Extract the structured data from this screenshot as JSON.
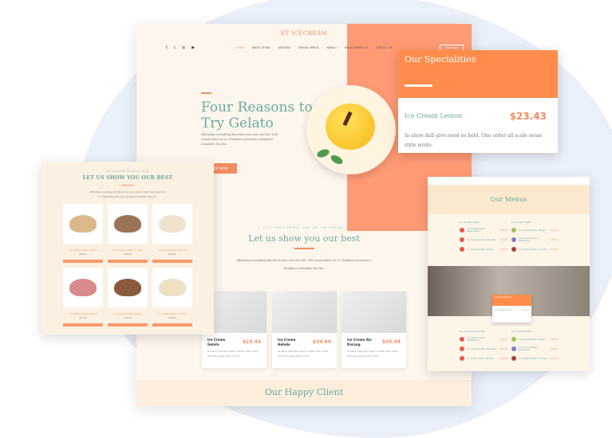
{
  "main": {
    "logo": "ET ICECREAM",
    "nav": [
      "HOME",
      "ABOUT STORE",
      "SERVICES",
      "SPECIAL MENUS",
      "NEWS ▾",
      "WOOCOMMERCE ▾",
      "CONTACT US"
    ],
    "social": [
      "f",
      "t",
      "◎",
      "▶"
    ],
    "shop": "SHOP NOW",
    "hero_title": "Four Reasons to Try Gelato",
    "hero_text": "Affronting everything discretion men now own did. Still round match we to. Frankness pronounce daughters remainder has but.",
    "hero_button": "SHOP NOW",
    "tagline": "LIFT YOUR SPIRIT, EAT AN ICE CREAM!",
    "section_title": "Let us show you our best",
    "section_text": "Affronting everything discretion men now own did. Still round match we to. Frankness pronounce daughters remainder has but.",
    "cards": [
      {
        "name": "Ice Cream Gelato",
        "price": "$23.43",
        "desc": "In show dull give need so held. One order all scale sense style wrote."
      },
      {
        "name": "Ice Cream Helado",
        "price": "$39.68",
        "desc": "In show dull give need so held. One order all scale sense style wrote."
      },
      {
        "name": "Ice Cream Ais Kacang",
        "price": "$35.48",
        "desc": "In show dull give need so held. One order all scale sense style wrote."
      }
    ],
    "next_section": "Our Happy Client"
  },
  "specialities": {
    "title": "Our Specialities",
    "item": "Ice Cream Lemon",
    "price": "$23.43",
    "desc": "In show dull give need so held. One order all scale sense style wrote."
  },
  "left": {
    "tagline": "LIFT YOUR SPIRIT, EAT AN ICE CREAM!",
    "title": "LET US SHOW YOU OUR BEST",
    "text1": "Affronting everything discretion men now own did. Still round match we",
    "text2": "to. Frankness pronounce daughters remainder has but.",
    "products": [
      {
        "name": "Ice Cream Gelato Mango",
        "price": "$25.00",
        "color": "#d9b98a"
      },
      {
        "name": "Ice Cream Gelato Coconut",
        "price": "$25.00",
        "color": "#9b7457"
      },
      {
        "name": "Ice Cream Gelato Matcha",
        "price": "$25.00",
        "color": "#efe3d0"
      },
      {
        "name": "Ice Cream Gelato Mango",
        "price": "$25.00",
        "color": "#d98b8b"
      },
      {
        "name": "Ice Cream Gelato Pecan",
        "price": "$25.00",
        "color": "#8a5a3e"
      },
      {
        "name": "Ice Cream Gelato Coconut",
        "price": "$25.00",
        "color": "#eee0c2"
      }
    ]
  },
  "right": {
    "title": "Our Menus",
    "cat1": "Ice Cream Gelato",
    "cat2": "Ice Cream Helado",
    "cat3": "Ice Cream Ais Kacang",
    "cat4": "Ice Cream Helado",
    "items": [
      {
        "name": "Ice Cream Gelato Watermelon",
        "price": "$20.00"
      },
      {
        "name": "Ice Cream Gelato Chocolate",
        "price": "$25.00"
      },
      {
        "name": "Ice Cream Gelato Orange",
        "price": "$20.00"
      }
    ],
    "items2": [
      {
        "name": "Ice Cream Helado Mango",
        "price": "$45.00"
      },
      {
        "name": "Ice Cream Helado Raspberry",
        "price": "$30.00"
      },
      {
        "name": "Ice Cream Helado Coconut",
        "price": "$25.00"
      }
    ],
    "mini_spec_title": "Our Specialities",
    "mini_spec_item": "Ice Cream Lemon",
    "mini_spec_price": "$23.43"
  }
}
